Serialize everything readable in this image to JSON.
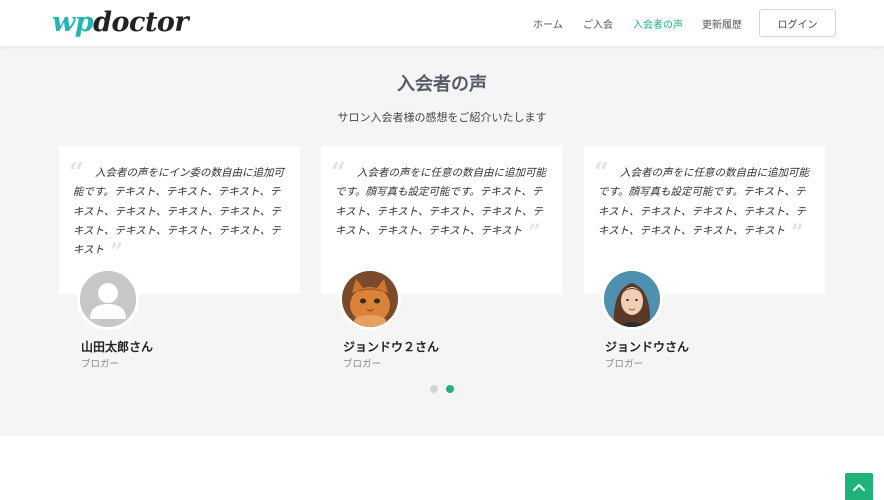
{
  "header": {
    "logo_wp": "wp",
    "logo_doctor": "doctor",
    "nav": [
      {
        "label": "ホーム"
      },
      {
        "label": "ご入会"
      },
      {
        "label": "入会者の声"
      },
      {
        "label": "更新履歴"
      }
    ],
    "login_label": "ログイン"
  },
  "section": {
    "title": "入会者の声",
    "subtitle": "サロン入会者様の感想をご紹介いたします"
  },
  "testimonials": [
    {
      "text": "入会者の声をにイン委の数自由に追加可能です。テキスト、テキスト、テキスト、テキスト、テキスト、テキスト、テキスト、テキスト、テキスト、テキスト、テキスト、テキスト",
      "name": "山田太郎さん",
      "role": "ブロガー"
    },
    {
      "text": "入会者の声をに任意の数自由に追加可能です。顔写真も設定可能です。テキスト、テキスト、テキスト、テキスト、テキスト、テキスト、テキスト、テキスト、テキスト",
      "name": "ジョンドウ２さん",
      "role": "ブロガー"
    },
    {
      "text": "入会者の声をに任意の数自由に追加可能です。顔写真も設定可能です。テキスト、テキスト、テキスト、テキスト、テキスト、テキスト、テキスト、テキスト、テキスト",
      "name": "ジョンドウさん",
      "role": "ブロガー"
    }
  ],
  "carousel": {
    "pages": 2,
    "active_page": 2
  },
  "colors": {
    "accent": "#1fb37a",
    "logo_teal": "#26b3b3",
    "section_bg": "#f5f5f5"
  },
  "icons": {
    "scroll_top": "chevron-up-icon",
    "quote_open": "quote-open-icon",
    "quote_close": "quote-close-icon"
  }
}
